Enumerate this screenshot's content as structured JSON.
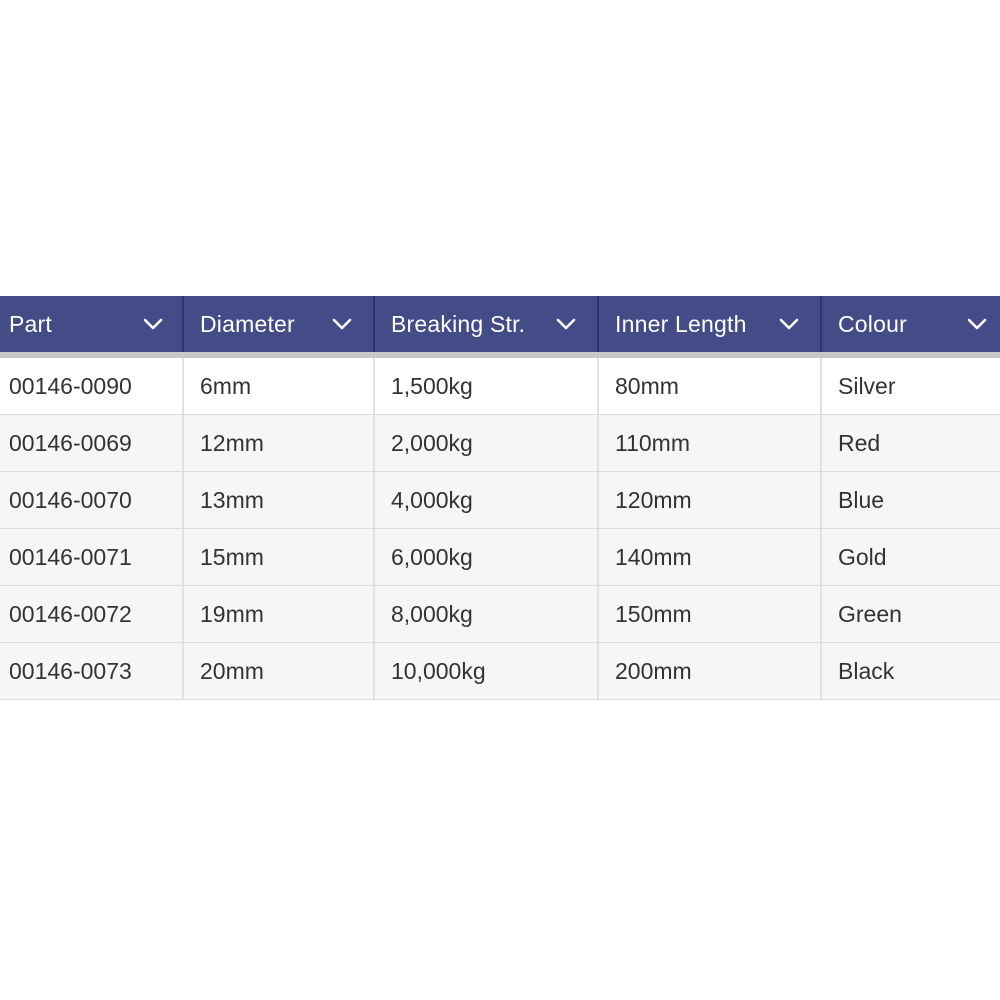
{
  "table": {
    "columns": [
      {
        "label": "Part"
      },
      {
        "label": "Diameter"
      },
      {
        "label": "Breaking Str."
      },
      {
        "label": "Inner Length"
      },
      {
        "label": "Colour"
      }
    ],
    "rows": [
      {
        "part": "00146-0090",
        "diameter": "6mm",
        "breaking": "1,500kg",
        "inner_length": "80mm",
        "colour": "Silver"
      },
      {
        "part": "00146-0069",
        "diameter": "12mm",
        "breaking": "2,000kg",
        "inner_length": "110mm",
        "colour": "Red"
      },
      {
        "part": "00146-0070",
        "diameter": "13mm",
        "breaking": "4,000kg",
        "inner_length": "120mm",
        "colour": "Blue"
      },
      {
        "part": "00146-0071",
        "diameter": "15mm",
        "breaking": "6,000kg",
        "inner_length": "140mm",
        "colour": "Gold"
      },
      {
        "part": "00146-0072",
        "diameter": "19mm",
        "breaking": "8,000kg",
        "inner_length": "150mm",
        "colour": "Green"
      },
      {
        "part": "00146-0073",
        "diameter": "20mm",
        "breaking": "10,000kg",
        "inner_length": "200mm",
        "colour": "Black"
      }
    ],
    "header_icon": "chevron-down-icon",
    "colors": {
      "header_bg": "#434c86",
      "header_text": "#ffffff",
      "row_alt_bg": "#f5f6f8",
      "text": "#333333"
    }
  }
}
